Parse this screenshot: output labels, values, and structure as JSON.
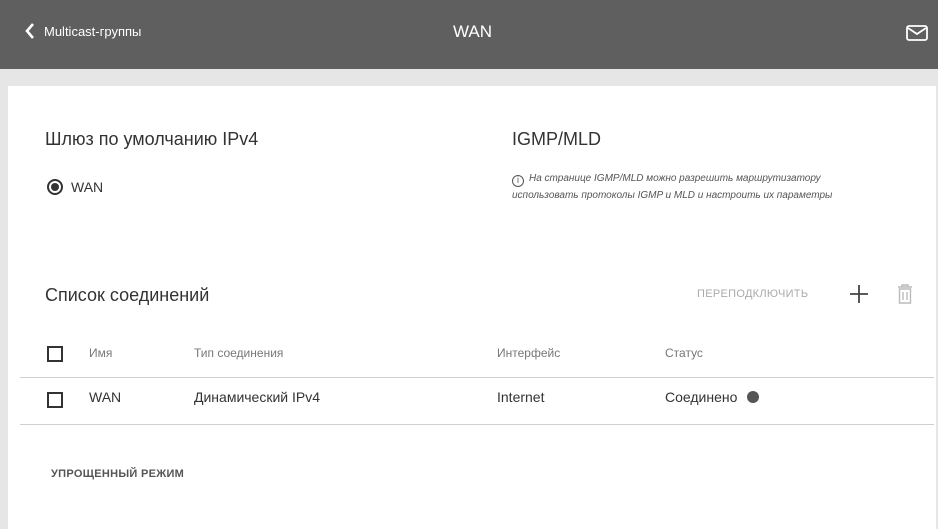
{
  "header": {
    "back_label": "Multicast-группы",
    "title": "WAN"
  },
  "gateway": {
    "title": "Шлюз по умолчанию IPv4",
    "option_label": "WAN"
  },
  "igmp": {
    "title": "IGMP/MLD",
    "info_line1": "На странице IGMP/MLD можно разрешить маршрутизатору",
    "info_line2": "использовать протоколы IGMP и MLD и настроить их параметры"
  },
  "connections": {
    "title": "Список соединений",
    "reconnect_label": "ПЕРЕПОДКЛЮЧИТЬ",
    "columns": [
      "Имя",
      "Тип соединения",
      "Интерфейс",
      "Статус"
    ],
    "rows": [
      {
        "name": "WAN",
        "type": "Динамический IPv4",
        "interface": "Internet",
        "status": "Соединено"
      }
    ]
  },
  "footer": {
    "simple_mode_label": "УПРОЩЕННЫЙ РЕЖИМ"
  }
}
